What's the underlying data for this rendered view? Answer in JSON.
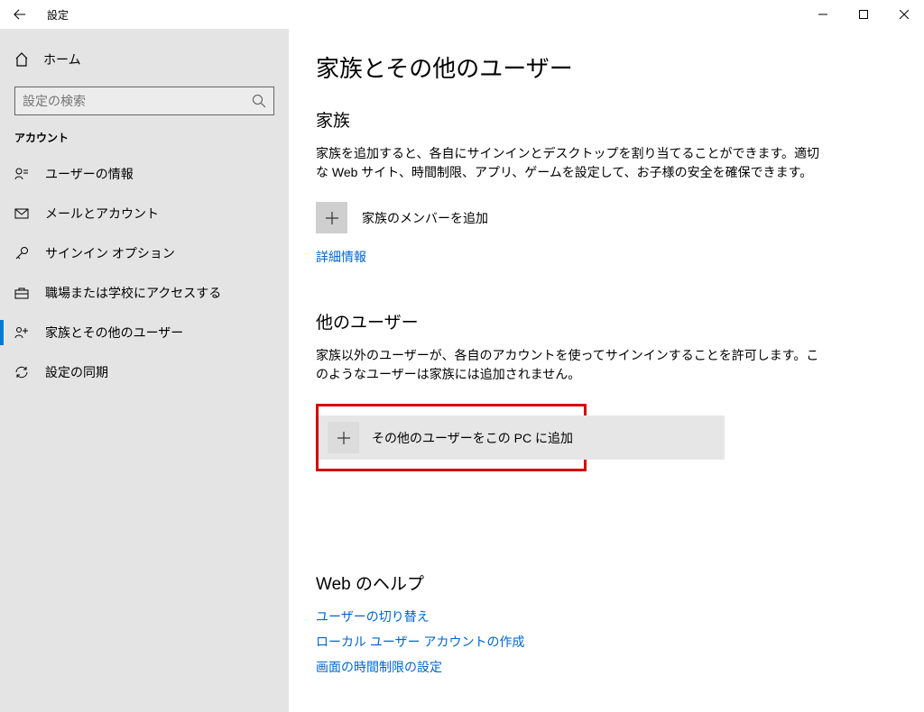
{
  "window": {
    "title": "設定"
  },
  "sidebar": {
    "home": "ホーム",
    "search_placeholder": "設定の検索",
    "section": "アカウント",
    "items": [
      {
        "label": "ユーザーの情報"
      },
      {
        "label": "メールとアカウント"
      },
      {
        "label": "サインイン オプション"
      },
      {
        "label": "職場または学校にアクセスする"
      },
      {
        "label": "家族とその他のユーザー"
      },
      {
        "label": "設定の同期"
      }
    ]
  },
  "main": {
    "title": "家族とその他のユーザー",
    "family": {
      "heading": "家族",
      "desc": "家族を追加すると、各自にサインインとデスクトップを割り当てることができます。適切な Web サイト、時間制限、アプリ、ゲームを設定して、お子様の安全を確保できます。",
      "add_label": "家族のメンバーを追加",
      "more_info": "詳細情報"
    },
    "others": {
      "heading": "他のユーザー",
      "desc": "家族以外のユーザーが、各自のアカウントを使ってサインインすることを許可します。このようなユーザーは家族には追加されません。",
      "add_label": "その他のユーザーをこの PC に追加"
    },
    "help": {
      "heading": "Web のヘルプ",
      "links": [
        "ユーザーの切り替え",
        "ローカル ユーザー アカウントの作成",
        "画面の時間制限の設定"
      ]
    }
  }
}
